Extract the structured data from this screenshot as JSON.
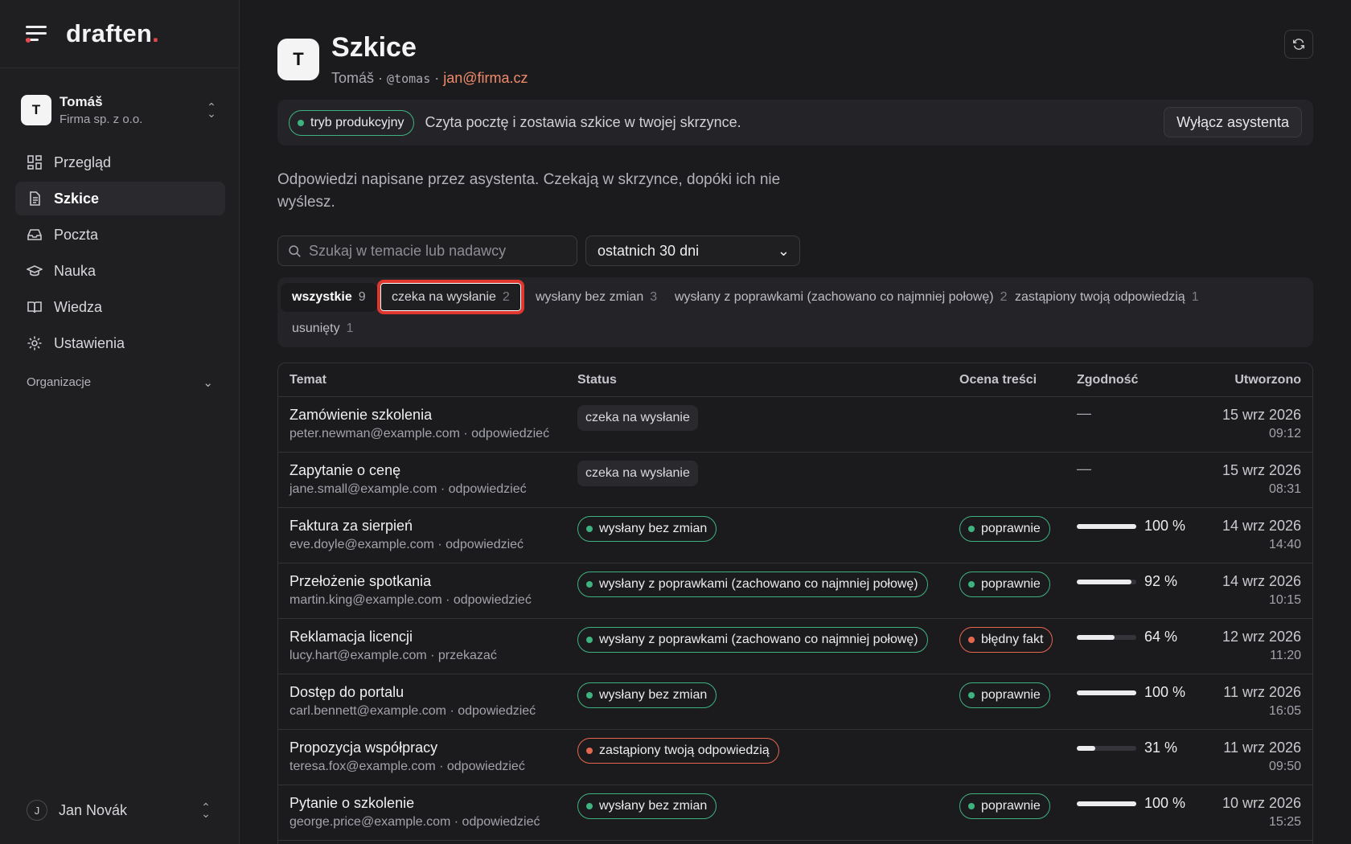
{
  "brand": {
    "logo_main": "draften",
    "logo_dot": "."
  },
  "workspace": {
    "initial": "T",
    "name": "Tomáš",
    "company": "Firma sp. z o.o."
  },
  "nav": [
    {
      "label": "Przegląd",
      "icon": "dashboard-icon"
    },
    {
      "label": "Szkice",
      "icon": "document-icon",
      "active": true
    },
    {
      "label": "Poczta",
      "icon": "inbox-icon"
    },
    {
      "label": "Nauka",
      "icon": "graduation-cap-icon"
    },
    {
      "label": "Wiedza",
      "icon": "book-icon"
    },
    {
      "label": "Ustawienia",
      "icon": "gear-icon"
    }
  ],
  "section": {
    "label": "Organizacje"
  },
  "user": {
    "initial": "J",
    "name": "Jan Novák"
  },
  "header": {
    "initial": "T",
    "title": "Szkice",
    "name": "Tomáš",
    "handle": "@tomas",
    "email": "jan@firma.cz",
    "sep": "·"
  },
  "banner": {
    "mode": "tryb produkcyjny",
    "desc": "Czyta pocztę i zostawia szkice w twojej skrzynce.",
    "button": "Wyłącz asystenta"
  },
  "intro": "Odpowiedzi napisane przez asystenta. Czekają w skrzynce, dopóki ich nie wyślesz.",
  "filters": {
    "search_placeholder": "Szukaj w temacie lub nadawcy",
    "range": "ostatnich 30 dni"
  },
  "tabs": [
    {
      "label": "wszystkie",
      "count": "9"
    },
    {
      "label": "czeka na wysłanie",
      "count": "2"
    },
    {
      "label": "wysłany bez zmian",
      "count": "3"
    },
    {
      "label": "wysłany z poprawkami (zachowano co najmniej połowę)",
      "count": "2"
    },
    {
      "label": "zastąpiony twoją odpowiedzią",
      "count": "1"
    },
    {
      "label": "usunięty",
      "count": "1"
    }
  ],
  "table": {
    "headers": {
      "temat": "Temat",
      "status": "Status",
      "ocena": "Ocena treści",
      "zgodnosc": "Zgodność",
      "utworzono": "Utworzono"
    },
    "rows": [
      {
        "subject": "Zamówienie szkolenia",
        "meta": "peter.newman@example.com · odpowiedzieć",
        "status": "czeka na wysłanie",
        "status_kind": "plain",
        "ocena": "",
        "ocena_kind": "",
        "zgodnosc": null,
        "zg_text": "—",
        "date": "15 wrz 2026",
        "time": "09:12"
      },
      {
        "subject": "Zapytanie o cenę",
        "meta": "jane.small@example.com · odpowiedzieć",
        "status": "czeka na wysłanie",
        "status_kind": "plain",
        "ocena": "",
        "ocena_kind": "",
        "zgodnosc": null,
        "zg_text": "—",
        "date": "15 wrz 2026",
        "time": "08:31"
      },
      {
        "subject": "Faktura za sierpień",
        "meta": "eve.doyle@example.com · odpowiedzieć",
        "status": "wysłany bez zmian",
        "status_kind": "green",
        "ocena": "poprawnie",
        "ocena_kind": "green",
        "zgodnosc": 100,
        "zg_text": "100 %",
        "date": "14 wrz 2026",
        "time": "14:40"
      },
      {
        "subject": "Przełożenie spotkania",
        "meta": "martin.king@example.com · odpowiedzieć",
        "status": "wysłany z poprawkami (zachowano co najmniej połowę)",
        "status_kind": "green",
        "ocena": "poprawnie",
        "ocena_kind": "green",
        "zgodnosc": 92,
        "zg_text": "92 %",
        "date": "14 wrz 2026",
        "time": "10:15"
      },
      {
        "subject": "Reklamacja licencji",
        "meta": "lucy.hart@example.com · przekazać",
        "status": "wysłany z poprawkami (zachowano co najmniej połowę)",
        "status_kind": "green",
        "ocena": "błędny fakt",
        "ocena_kind": "red",
        "zgodnosc": 64,
        "zg_text": "64 %",
        "date": "12 wrz 2026",
        "time": "11:20"
      },
      {
        "subject": "Dostęp do portalu",
        "meta": "carl.bennett@example.com · odpowiedzieć",
        "status": "wysłany bez zmian",
        "status_kind": "green",
        "ocena": "poprawnie",
        "ocena_kind": "green",
        "zgodnosc": 100,
        "zg_text": "100 %",
        "date": "11 wrz 2026",
        "time": "16:05"
      },
      {
        "subject": "Propozycja współpracy",
        "meta": "teresa.fox@example.com · odpowiedzieć",
        "status": "zastąpiony twoją odpowiedzią",
        "status_kind": "red",
        "ocena": "",
        "ocena_kind": "",
        "zgodnosc": 31,
        "zg_text": "31 %",
        "date": "11 wrz 2026",
        "time": "09:50"
      },
      {
        "subject": "Pytanie o szkolenie",
        "meta": "george.price@example.com · odpowiedzieć",
        "status": "wysłany bez zmian",
        "status_kind": "green",
        "ocena": "poprawnie",
        "ocena_kind": "green",
        "zgodnosc": 100,
        "zg_text": "100 %",
        "date": "10 wrz 2026",
        "time": "15:25"
      }
    ]
  },
  "colors": {
    "accent": "#e5484d",
    "green": "#3fb37f",
    "red": "#e5674d",
    "email": "#f08a6b"
  }
}
